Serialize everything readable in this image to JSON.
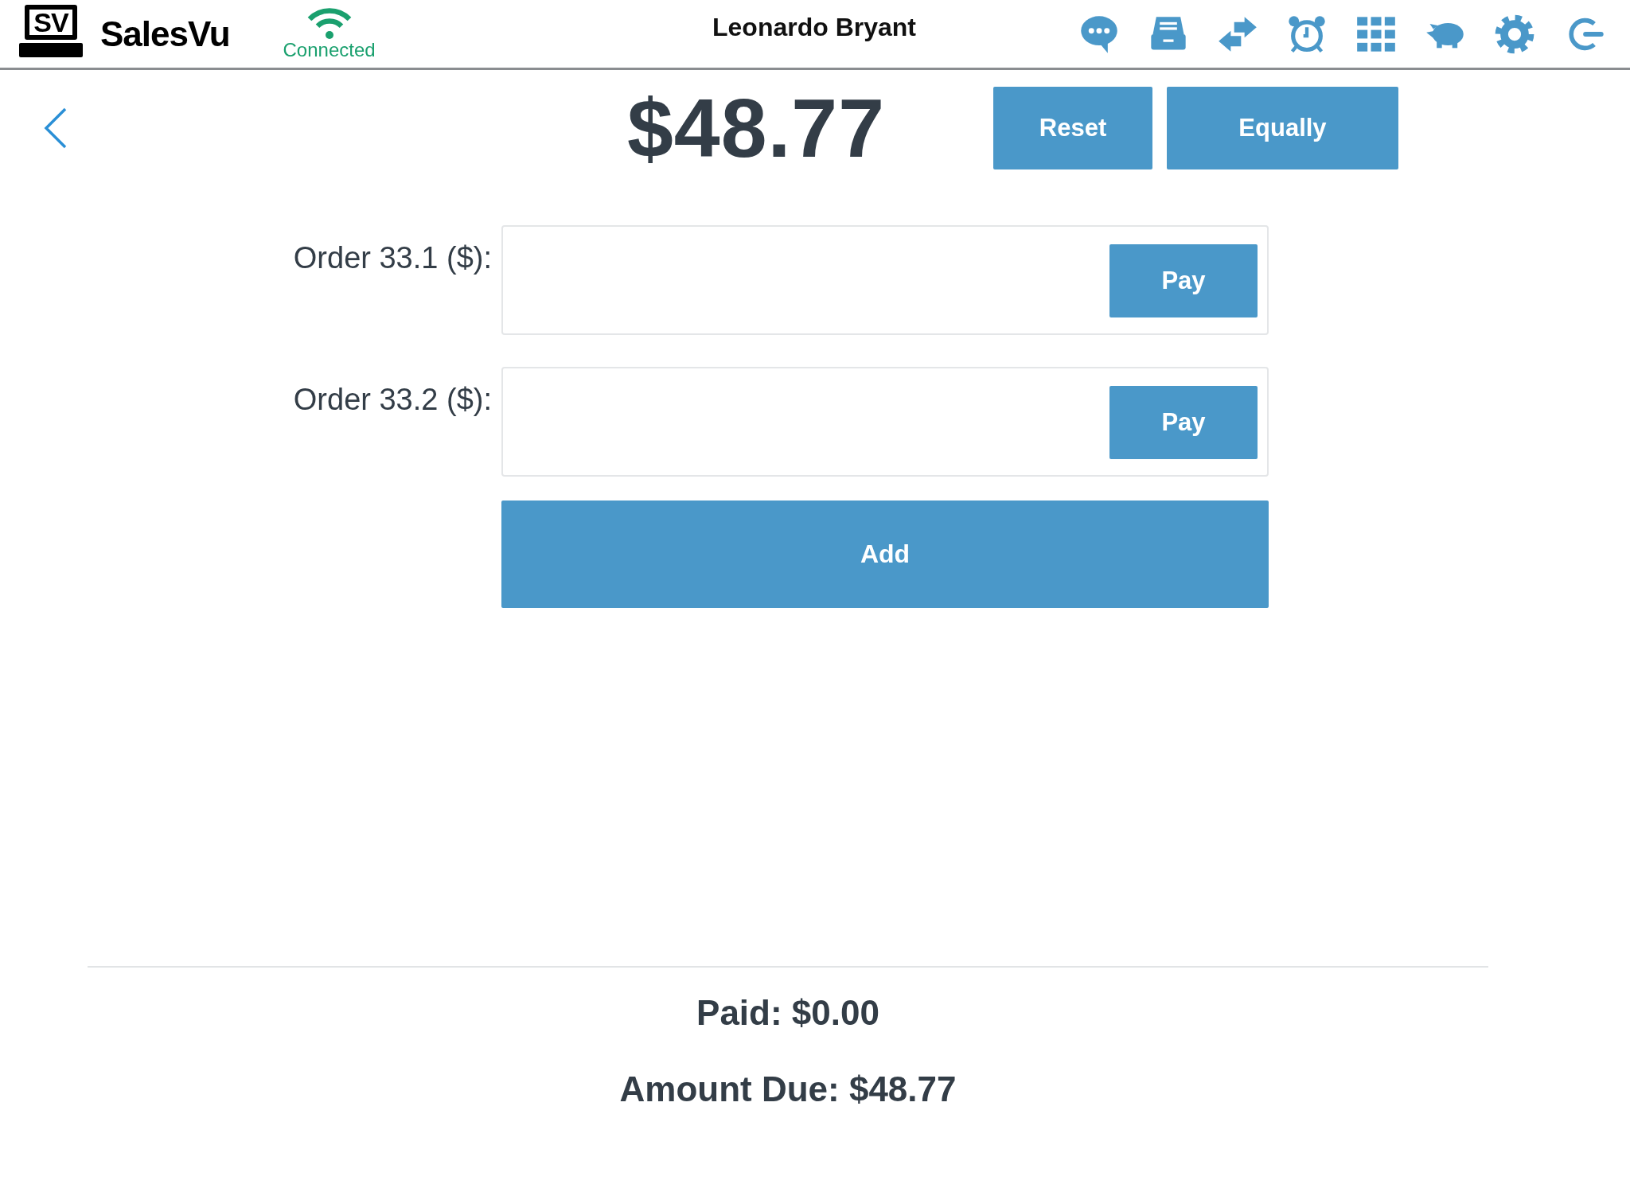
{
  "header": {
    "logo_mark": "SV",
    "brand": "SalesVu",
    "connection": {
      "label": "Connected",
      "connected": true
    },
    "user": "Leonardo Bryant",
    "toolbar": [
      {
        "kind": "chat"
      },
      {
        "kind": "drawer"
      },
      {
        "kind": "transfer"
      },
      {
        "kind": "alarm"
      },
      {
        "kind": "grid"
      },
      {
        "kind": "piggy"
      },
      {
        "kind": "settings"
      },
      {
        "kind": "logout"
      }
    ]
  },
  "split": {
    "total": "$48.77",
    "actions": [
      "Reset",
      "Equally"
    ],
    "orders": [
      {
        "label": "Order 33.1 ($):",
        "button": "Pay"
      },
      {
        "label": "Order 33.2 ($):",
        "button": "Pay"
      }
    ],
    "add_button": "Add"
  },
  "summary": [
    "Paid: $0.00",
    "Amount Due: $48.77"
  ]
}
